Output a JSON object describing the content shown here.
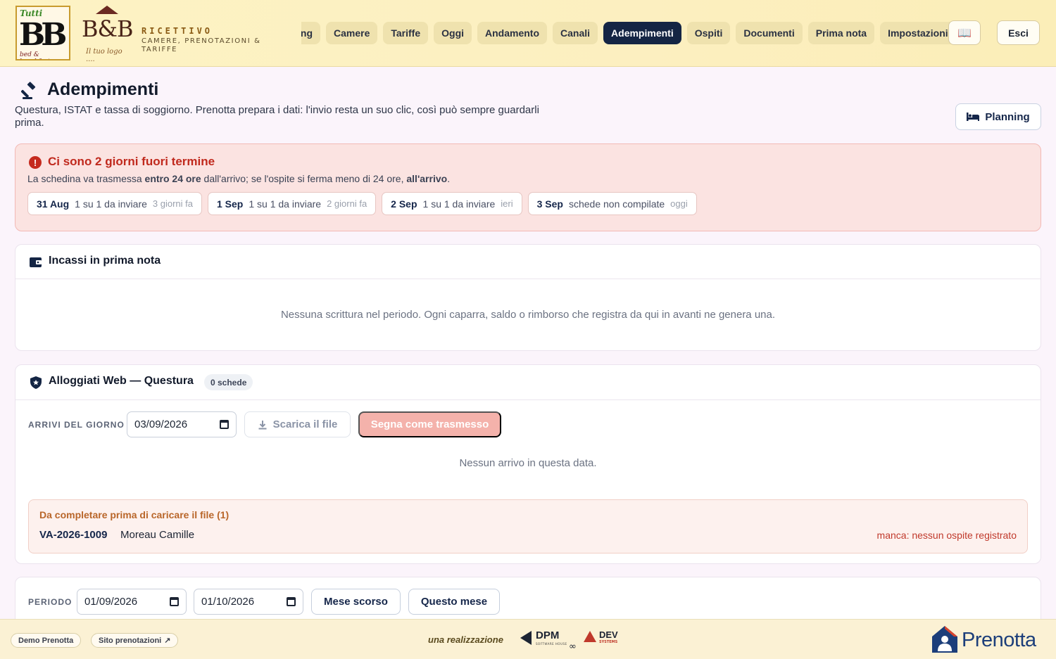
{
  "brand": {
    "logo_big": "BB",
    "logo_leaves": "Tutti",
    "logo_small": "bed & breakfast",
    "house_logo": "B&B",
    "house_tag": "Il tuo logo ....",
    "title": "RICETTIVO",
    "subtitle": "CAMERE, PRENOTAZIONI & TARIFFE"
  },
  "nav": {
    "cut_label": "ng",
    "items": [
      "Camere",
      "Tariffe",
      "Oggi",
      "Andamento",
      "Canali",
      "Adempimenti",
      "Ospiti",
      "Documenti",
      "Prima nota",
      "Impostazioni"
    ],
    "active": "Adempimenti",
    "book_icon": "book-icon",
    "exit_label": "Esci"
  },
  "page": {
    "title": "Adempimenti",
    "title_icon": "gavel-icon",
    "description": "Questura, ISTAT e tassa di soggiorno. Prenotta prepara i dati: l'invio resta un suo clic, così può sempre guardarli prima.",
    "planning_label": "Planning"
  },
  "alert": {
    "title": "Ci sono 2 giorni fuori termine",
    "text_1": "La schedina va trasmessa ",
    "text_bold_1": "entro 24 ore",
    "text_2": " dall'arrivo; se l'ospite si ferma meno di 24 ore, ",
    "text_bold_2": "all'arrivo",
    "text_3": ".",
    "chips": [
      {
        "date": "31 Aug",
        "status": "1 su 1 da inviare",
        "ago": "3 giorni fa"
      },
      {
        "date": "1 Sep",
        "status": "1 su 1 da inviare",
        "ago": "2 giorni fa"
      },
      {
        "date": "2 Sep",
        "status": "1 su 1 da inviare",
        "ago": "ieri"
      },
      {
        "date": "3 Sep",
        "status": "schede non compilate",
        "ago": "oggi"
      }
    ]
  },
  "incassi": {
    "title": "Incassi in prima nota",
    "empty": "Nessuna scrittura nel periodo. Ogni caparra, saldo o rimborso che registra da qui in avanti ne genera una."
  },
  "questura": {
    "title": "Alloggiati Web — Questura",
    "badge": "0 schede",
    "arrivals_label": "ARRIVI DEL GIORNO",
    "date": "03/09/2026",
    "download_label": "Scarica il file",
    "mark_label": "Segna come trasmesso",
    "empty": "Nessun arrivo in questa data.",
    "todo": {
      "heading": "Da completare prima di caricare il file (1)",
      "code": "VA-2026-1009",
      "name": "Moreau Camille",
      "missing": "manca: nessun ospite registrato"
    }
  },
  "periodo": {
    "label": "PERIODO",
    "from": "01/09/2026",
    "to": "01/10/2026",
    "last_month": "Mese scorso",
    "this_month": "Questo mese"
  },
  "footer": {
    "demo": "Demo Prenotta",
    "site": "Sito prenotazioni",
    "realiz": "una realizzazione",
    "dpm": "DPM",
    "dpm_sub": "SOFTWARE HOUSE",
    "dev": "DEV",
    "dev_sub": "SYSTEMS",
    "brand": "Prenotta"
  },
  "colors": {
    "accent_navy": "#142544",
    "alert_red": "#c0291d",
    "header_bg": "#fcefc0"
  }
}
